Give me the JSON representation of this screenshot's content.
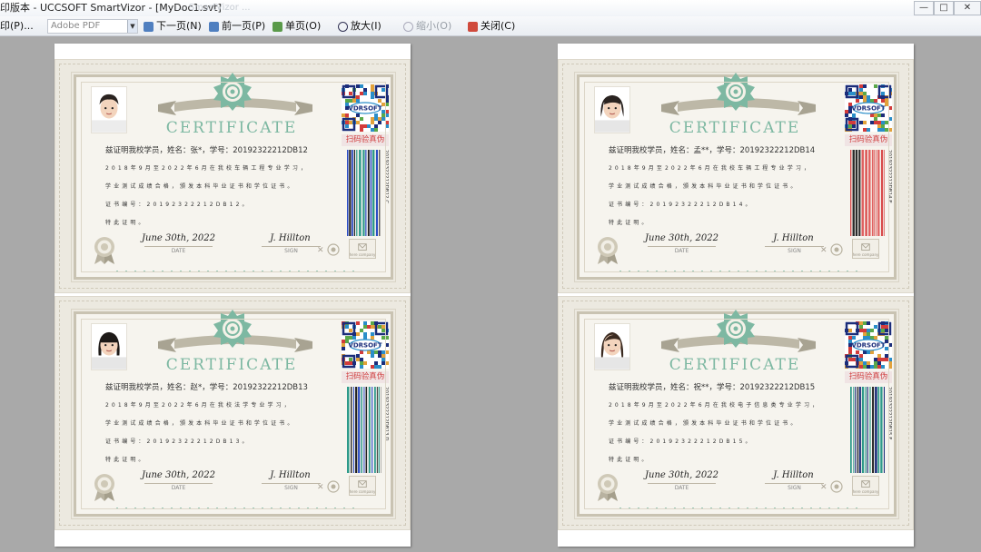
{
  "window": {
    "title": "印版本 - UCCSOFT SmartVizor - [MyDoc1.svt]",
    "ghost_text": "... SmartVizor ...",
    "buttons": [
      "—",
      "□",
      "✕"
    ]
  },
  "toolbar": {
    "print_label": "印(P)...",
    "printer": "Adobe PDF",
    "next_page": "下一页(N)",
    "prev_page": "前一页(P)",
    "single_page": "单页(O)",
    "zoom_in": "放大(I)",
    "zoom_out": "缩小(O)",
    "close": "关闭(C)"
  },
  "certificate_common": {
    "title": "CERTIFICATE",
    "qr_label": "扫码验真伪",
    "qr_logo": "VDRSOFT",
    "line3": "学 业 测 试 成 绩 合 格 ， 颁 发 本 科 毕 业 证 书 和 学 位 证 书 。",
    "line5": "特 此 证 明 。",
    "date_sig": "June 30th, 2022",
    "date_label": "DATE",
    "name_sig": "J. Hillton",
    "name_label": "SIGN",
    "stamp_label": "here company"
  },
  "certificates": [
    {
      "line1": "兹证明我校学员，姓名：张*，学号：20192322212DB12",
      "line2": "2 0 1 8 年 9 月 至 2 0 2 2 年 6 月 在 我 校  车 辆 工 程 专 业 学 习 ，",
      "line4": "证 书 编 号 ：  2 0 1 9 2 3 2 2 2 1 2 D B 1 2 。",
      "barcode_text": "20192322212DB12 C",
      "gender": "male"
    },
    {
      "line1": "兹证明我校学员，姓名：孟**，学号：20192322212DB14",
      "line2": "2 0 1 8 年 9 月 至 2 0 2 2 年 6 月 在 我 校  车 辆 工 程 专 业 学 习 ，",
      "line4": "证 书 编 号 ：  2 0 1 9 2 3 2 2 2 1 2 D B 1 4 。",
      "barcode_text": "20192322212DB14 E",
      "gender": "female"
    },
    {
      "line1": "兹证明我校学员，姓名：赵*，学号：20192322212DB13",
      "line2": "2 0 1 8 年 9 月 至 2 0 2 2 年 6 月 在 我 校  法 学 专 业 学 习 ，",
      "line4": "证 书 编 号 ：  2 0 1 9 2 3 2 2 2 1 2 D B 1 3 。",
      "barcode_text": "20192322212DB13 D",
      "gender": "female2"
    },
    {
      "line1": "兹证明我校学员，姓名：祝**，学号：20192322212DB15",
      "line2": "2 0 1 8 年 9 月 至 2 0 2 2 年 6 月 在 我 校  电 子 信 息 类 专 业 学 习 ，",
      "line4": "证 书 编 号 ：  2 0 1 9 2 3 2 2 2 1 2 D B 1 5 。",
      "barcode_text": "20192322212DB15 F",
      "gender": "female3"
    }
  ],
  "colors": {
    "accent_green": "#7db8a2",
    "qr_label_red": "#d04040",
    "workspace_gray": "#a9a9a9"
  }
}
